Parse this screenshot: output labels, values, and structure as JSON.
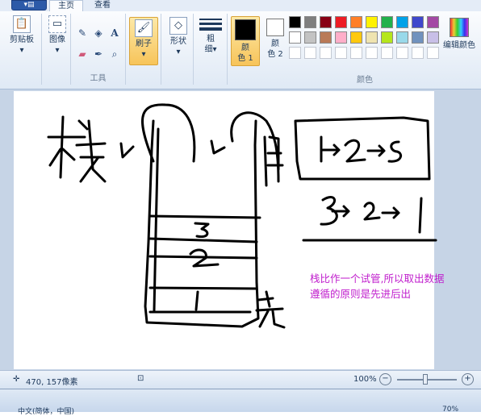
{
  "tabs": {
    "file_icon": "file-menu-icon",
    "home": "主页",
    "view": "查看"
  },
  "clipboard": {
    "paste_label": "剪贴板"
  },
  "image": {
    "label": "图像"
  },
  "tools": {
    "group_label": "工具",
    "icons": [
      "pencil-icon",
      "fill-icon",
      "text-icon",
      "eraser-icon",
      "color-picker-icon",
      "magnifier-icon"
    ]
  },
  "brush": {
    "label": "刷子"
  },
  "shapes": {
    "label": "形状"
  },
  "size": {
    "label_top": "粗",
    "label_bottom": "细"
  },
  "color1": {
    "label_top": "颜",
    "label_bottom": "色 1",
    "value": "#000000"
  },
  "color2": {
    "label_top": "颜",
    "label_bottom": "色 2",
    "value": "#ffffff"
  },
  "colors": {
    "group_label": "颜色",
    "row1": [
      "#000000",
      "#7f7f7f",
      "#880015",
      "#ed1c24",
      "#ff7f27",
      "#fff200",
      "#22b14c",
      "#00a2e8",
      "#3f48cc",
      "#a349a4"
    ],
    "row2": [
      "#ffffff",
      "#c3c3c3",
      "#b97a57",
      "#ffaec9",
      "#ffc90e",
      "#efe4b0",
      "#b5e61d",
      "#99d9ea",
      "#7092be",
      "#c8bfe7"
    ],
    "row3": [
      "#ffffff",
      "#ffffff",
      "#ffffff",
      "#ffffff",
      "#ffffff",
      "#ffffff",
      "#ffffff",
      "#ffffff",
      "#ffffff",
      "#ffffff"
    ]
  },
  "edit_colors": {
    "label": "编辑颜色"
  },
  "canvas": {
    "annotation_line1": "栈比作一个试管,所以取出数据",
    "annotation_line2": "遵循的原则是先进后出"
  },
  "status": {
    "coords": "470, 157像素",
    "zoom": "100%"
  },
  "taskbar": {
    "ime": "中文(简体，中国)",
    "zoom": "70%"
  }
}
